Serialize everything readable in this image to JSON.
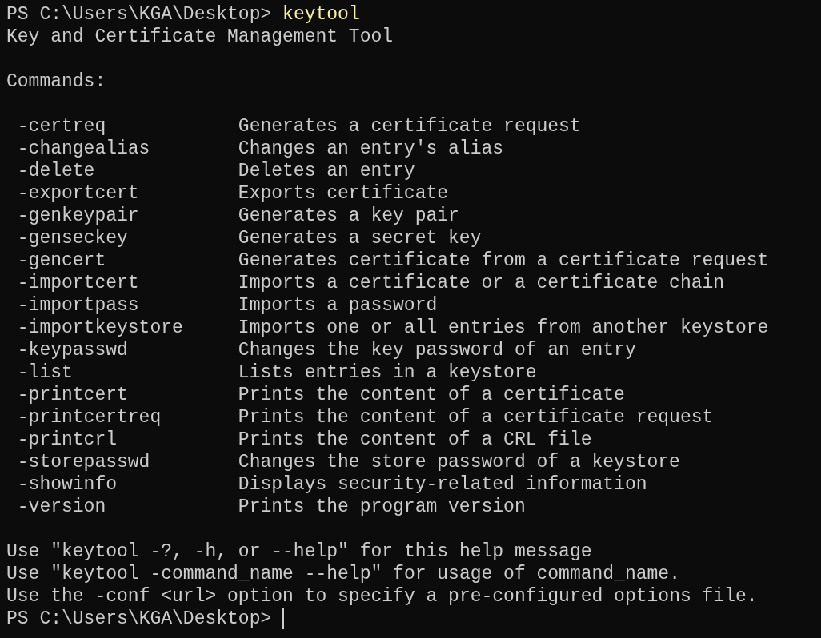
{
  "prompt": {
    "path": "PS C:\\Users\\KGA\\Desktop>",
    "command": "keytool"
  },
  "title": "Key and Certificate Management Tool",
  "heading": "Commands:",
  "commands": [
    {
      "name": "-certreq",
      "description": "Generates a certificate request"
    },
    {
      "name": "-changealias",
      "description": "Changes an entry's alias"
    },
    {
      "name": "-delete",
      "description": "Deletes an entry"
    },
    {
      "name": "-exportcert",
      "description": "Exports certificate"
    },
    {
      "name": "-genkeypair",
      "description": "Generates a key pair"
    },
    {
      "name": "-genseckey",
      "description": "Generates a secret key"
    },
    {
      "name": "-gencert",
      "description": "Generates certificate from a certificate request"
    },
    {
      "name": "-importcert",
      "description": "Imports a certificate or a certificate chain"
    },
    {
      "name": "-importpass",
      "description": "Imports a password"
    },
    {
      "name": "-importkeystore",
      "description": "Imports one or all entries from another keystore"
    },
    {
      "name": "-keypasswd",
      "description": "Changes the key password of an entry"
    },
    {
      "name": "-list",
      "description": "Lists entries in a keystore"
    },
    {
      "name": "-printcert",
      "description": "Prints the content of a certificate"
    },
    {
      "name": "-printcertreq",
      "description": "Prints the content of a certificate request"
    },
    {
      "name": "-printcrl",
      "description": "Prints the content of a CRL file"
    },
    {
      "name": "-storepasswd",
      "description": "Changes the store password of a keystore"
    },
    {
      "name": "-showinfo",
      "description": "Displays security-related information"
    },
    {
      "name": "-version",
      "description": "Prints the program version"
    }
  ],
  "footer": [
    "Use \"keytool -?, -h, or --help\" for this help message",
    "Use \"keytool -command_name --help\" for usage of command_name.",
    "Use the -conf <url> option to specify a pre-configured options file."
  ],
  "final_prompt": {
    "path": "PS C:\\Users\\KGA\\Desktop>"
  }
}
